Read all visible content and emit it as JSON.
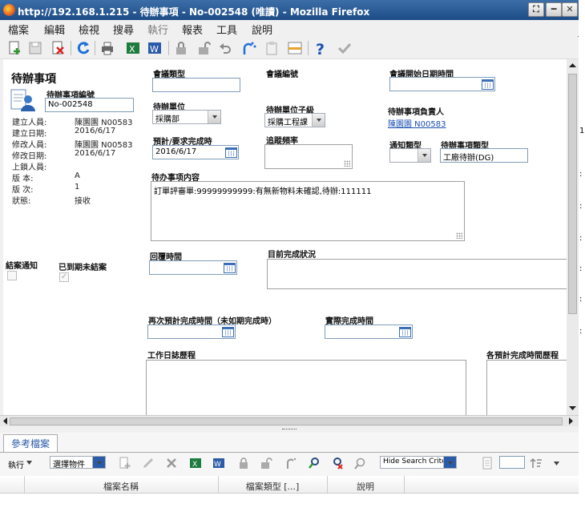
{
  "window": {
    "title": "http://192.168.1.215 - 待辦事項 - No-002548 (唯讀) - Mozilla Firefox",
    "controls": [
      "⛶",
      "━",
      "✕"
    ]
  },
  "menu": [
    {
      "label": "檔案",
      "enabled": true
    },
    {
      "label": "編輯",
      "enabled": true
    },
    {
      "label": "檢視",
      "enabled": true
    },
    {
      "label": "搜尋",
      "enabled": true
    },
    {
      "label": "執行",
      "enabled": false
    },
    {
      "label": "報表",
      "enabled": true
    },
    {
      "label": "工具",
      "enabled": true
    },
    {
      "label": "說明",
      "enabled": true
    }
  ],
  "toolbar": [
    "new-icon",
    "save-icon",
    "delete-icon",
    "refresh-icon",
    "print-icon",
    "excel-icon",
    "word-icon",
    "lock-icon",
    "unlock-icon",
    "undo-icon",
    "redirect-icon",
    "paste-icon",
    "layout-icon",
    "help-icon",
    "confirm-icon"
  ],
  "form": {
    "heading": "待辦事項",
    "number_label": "待辦事項編號",
    "number_value": "No-002548",
    "meta": [
      {
        "label": "建立人員:",
        "value": "陳園園 N00583"
      },
      {
        "label": "建立日期:",
        "value": "2016/6/17"
      },
      {
        "label": "修改人員:",
        "value": "陳園園 N00583"
      },
      {
        "label": "修改日期:",
        "value": "2016/6/17"
      },
      {
        "label": "上鎖人員:",
        "value": ""
      },
      {
        "label": "版 本:",
        "value": "A"
      },
      {
        "label": "版 次:",
        "value": "1"
      },
      {
        "label": "狀態:",
        "value": "接收"
      }
    ],
    "meeting_type_label": "會議類型",
    "meeting_type_value": "",
    "meeting_no_label": "會議編號",
    "meeting_start_label": "會議開始日期時間",
    "meeting_start_value": "",
    "todo_unit_label": "待辦單位",
    "todo_unit_value": "採購部",
    "todo_subunit_label": "待辦單位子級",
    "todo_subunit_value": "採購工程課",
    "owner_label": "待辦事項負責人",
    "owner_value": "陳園園 N00583",
    "due_label": "預計/要求完成時",
    "due_value": "2016/6/17",
    "tracking_label": "追蹤頻率",
    "tracking_value": "",
    "notify_type_label": "通知類型",
    "notify_type_value": "",
    "todo_type_label": "待辦事項類型",
    "todo_type_value": "工廠待辦(DG)",
    "content_label": "待办事项内容",
    "content_value": "訂單評審單:99999999999:有無新物料未確認,待辦:111111",
    "close_notify_label": "結案通知",
    "overdue_label": "已到期未結案",
    "reply_time_label": "回覆時間",
    "reply_time_value": "",
    "status_label": "目前完成狀況",
    "status_value": "",
    "re_estimate_label": "再次預計完成時間（未如期完成時）",
    "re_estimate_value": "",
    "actual_label": "實際完成時間",
    "actual_value": "",
    "worklog_label": "工作日誌歷程",
    "history_label": "各預計完成時間歷程"
  },
  "right_strip": [
    "1",
    "",
    "",
    "",
    ":",
    "",
    ":",
    ":",
    ":",
    ":",
    ":"
  ],
  "bottom": {
    "tab": "參考檔案",
    "execute": "執行",
    "object_select": "選擇物件",
    "search_mode": "Hide Search Criteria",
    "columns": [
      "檔案名稱",
      "檔案類型 [...]",
      "說明"
    ]
  }
}
